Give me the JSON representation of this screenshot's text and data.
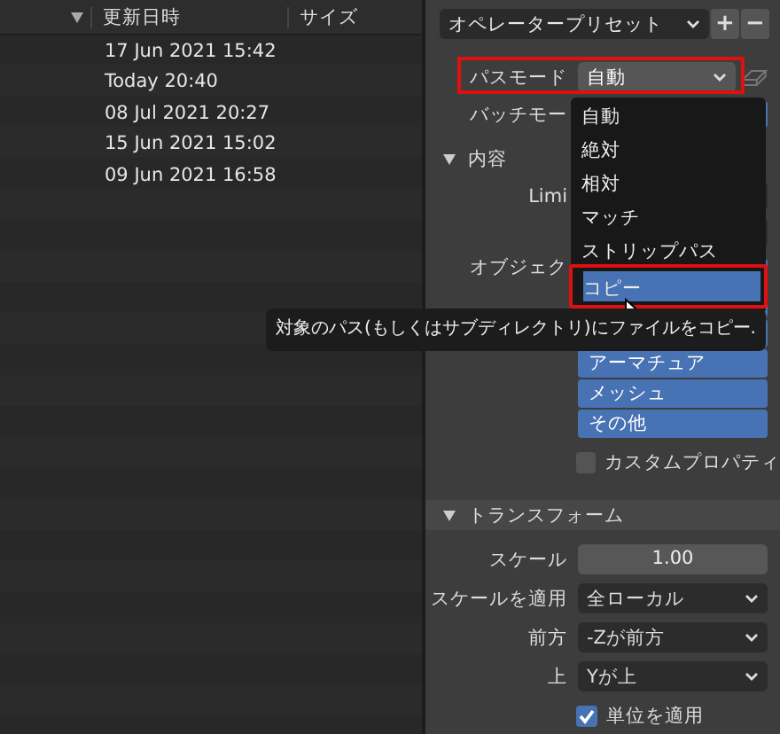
{
  "file_list": {
    "columns": [
      "更新日時",
      "サイズ"
    ],
    "rows": [
      {
        "modified": "17 Jun 2021 15:42"
      },
      {
        "modified": "Today 20:40"
      },
      {
        "modified": "08 Jul 2021 20:27"
      },
      {
        "modified": "15 Jun 2021 15:02"
      },
      {
        "modified": "09 Jun 2021 16:58"
      }
    ]
  },
  "operator_preset": {
    "value": "オペレータープリセット",
    "buttons": [
      "+",
      "−"
    ]
  },
  "path_mode": {
    "label": "パスモード",
    "value": "自動",
    "highlighted": true
  },
  "batch_mode": {
    "label": "バッチモー"
  },
  "include_section": {
    "title": "内容",
    "expanded": true,
    "limit_label": "Limi",
    "object_label": "オブジェク",
    "object_types": [
      {
        "label": "アーマチュア",
        "selected": true
      },
      {
        "label": "メッシュ",
        "selected": true
      },
      {
        "label": "その他",
        "selected": true
      }
    ],
    "custom_properties": {
      "label": "カスタムプロパティ",
      "checked": false
    }
  },
  "transform_section": {
    "title": "トランスフォーム",
    "expanded": true,
    "fields": [
      {
        "kind": "number",
        "label": "スケール",
        "value": "1.00"
      },
      {
        "kind": "dropdown",
        "label": "スケールを適用",
        "value": "全ローカル"
      },
      {
        "kind": "dropdown",
        "label": "前方",
        "value": "-Zが前方"
      },
      {
        "kind": "dropdown",
        "label": "上",
        "value": "Yが上"
      }
    ],
    "apply_unit": {
      "label": "単位を適用",
      "checked": true
    }
  },
  "path_mode_menu": {
    "items": [
      {
        "label": "自動",
        "selected": false
      },
      {
        "label": "絶対",
        "selected": false
      },
      {
        "label": "相対",
        "selected": false
      },
      {
        "label": "マッチ",
        "selected": false
      },
      {
        "label": "ストリップパス",
        "selected": false
      },
      {
        "label": "コピー",
        "selected": true,
        "highlighted": true
      }
    ]
  },
  "tooltip": {
    "text": "対象のパス(もしくはサブディレクトリ)にファイルをコピー."
  }
}
